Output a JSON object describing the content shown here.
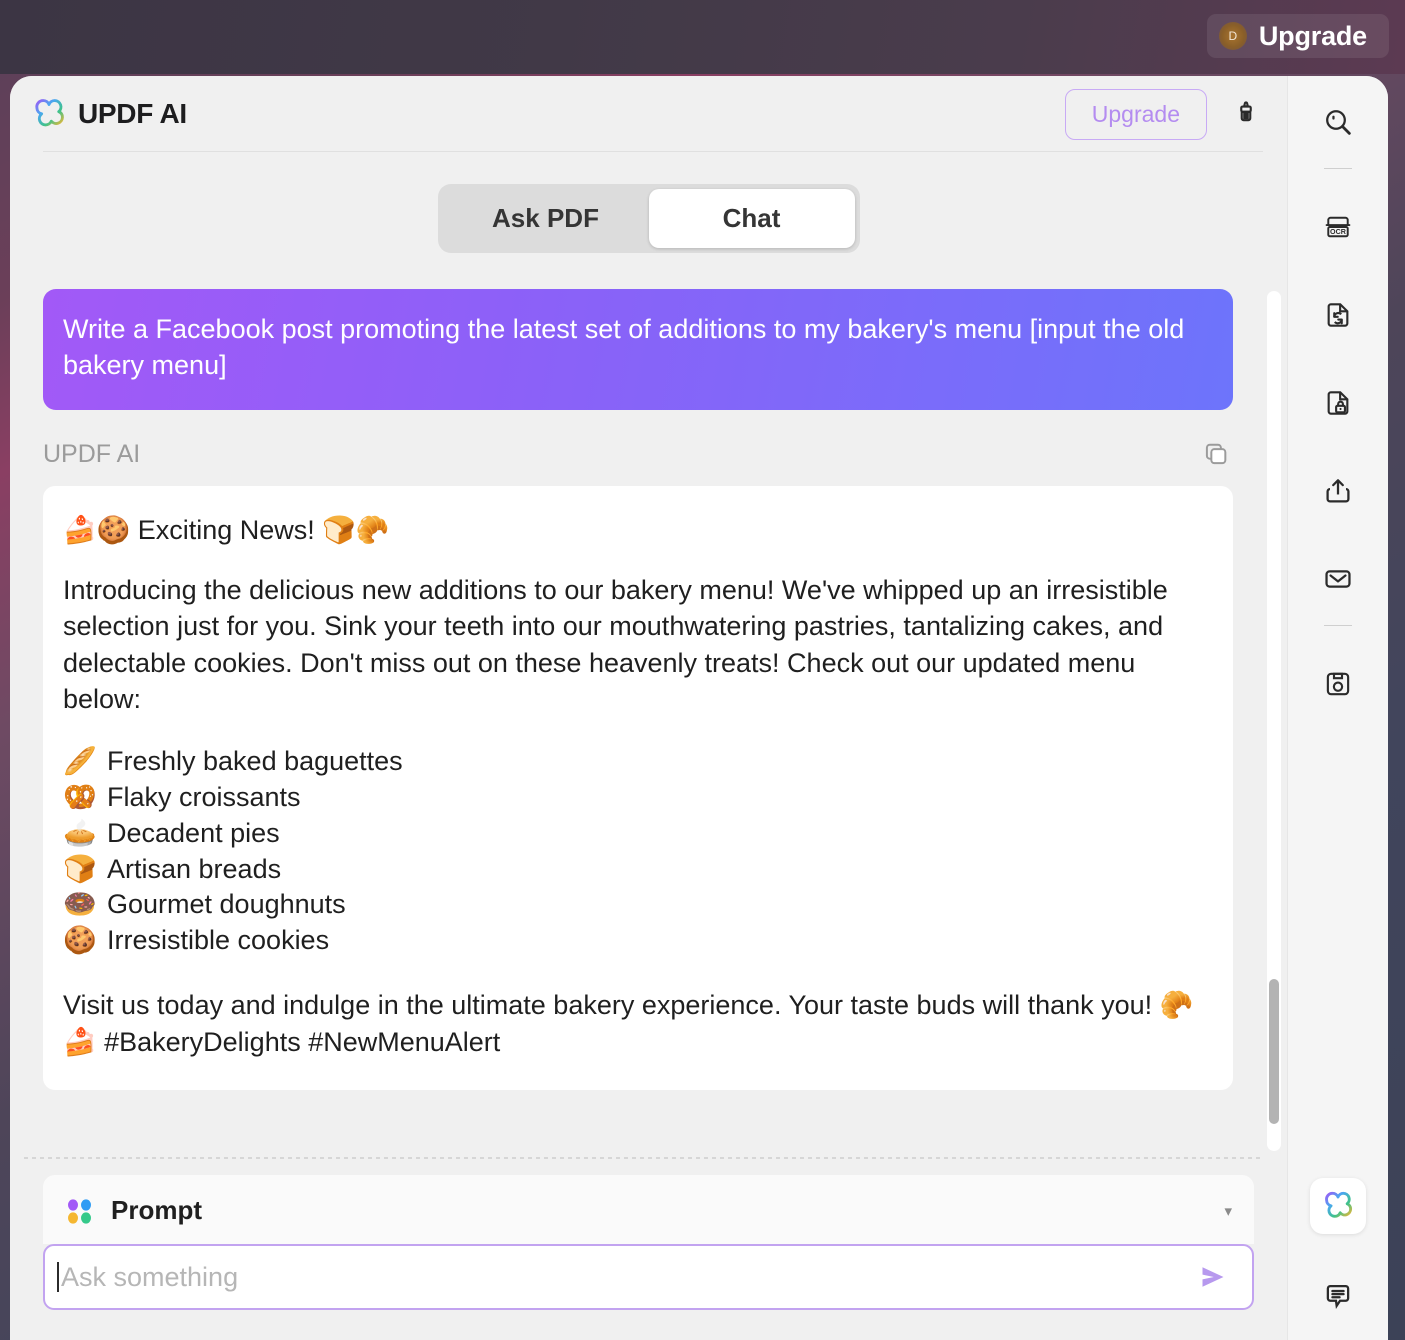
{
  "desktop": {
    "upgrade": {
      "avatar_initial": "D",
      "label": "Upgrade"
    }
  },
  "app": {
    "title": "UPDF AI",
    "header": {
      "upgrade_label": "Upgrade",
      "brush_icon": "brush-icon",
      "logo_icon": "updf-clover-logo-icon"
    },
    "tabs": [
      {
        "label": "Ask PDF",
        "active": false
      },
      {
        "label": "Chat",
        "active": true
      }
    ]
  },
  "chat": {
    "user_message": "Write a Facebook post promoting the latest set of additions to my bakery's menu [input the old bakery menu]",
    "assistant_label": "UPDF AI",
    "copy_icon": "copy-icon",
    "response": {
      "headline": "🍰🍪 Exciting News! 🍞🥐",
      "intro": "Introducing the delicious new additions to our bakery menu! We've whipped up an irresistible selection just for you. Sink your teeth into our mouthwatering pastries, tantalizing cakes, and delectable cookies. Don't miss out on these heavenly treats! Check out our updated menu below:",
      "menu_items": [
        {
          "emoji": "🥖",
          "text": "Freshly baked baguettes"
        },
        {
          "emoji": "🥨",
          "text": "Flaky croissants"
        },
        {
          "emoji": "🥧",
          "text": "Decadent pies"
        },
        {
          "emoji": "🍞",
          "text": "Artisan breads"
        },
        {
          "emoji": "🍩",
          "text": "Gourmet doughnuts"
        },
        {
          "emoji": "🍪",
          "text": "Irresistible cookies"
        }
      ],
      "closing": "Visit us today and indulge in the ultimate bakery experience. Your taste buds will thank you! 🥐🍰 #BakeryDelights #NewMenuAlert"
    }
  },
  "prompt": {
    "label": "Prompt",
    "dots_icon": "four-dots-icon",
    "caret": "▾",
    "input_value": "",
    "placeholder": "Ask something",
    "send_icon": "send-icon"
  },
  "tool_rail": {
    "items": [
      {
        "name": "search-icon",
        "label": "Search"
      },
      {
        "name": "ocr-icon",
        "label": "OCR"
      },
      {
        "name": "convert-document-icon",
        "label": "Convert"
      },
      {
        "name": "protect-document-icon",
        "label": "Protect"
      },
      {
        "name": "share-export-icon",
        "label": "Share"
      },
      {
        "name": "mail-icon",
        "label": "Email"
      },
      {
        "name": "save-floppy-icon",
        "label": "Save"
      }
    ],
    "bottom": [
      {
        "name": "updf-ai-clover-icon",
        "label": "UPDF AI"
      },
      {
        "name": "comment-icon",
        "label": "Comment"
      }
    ]
  },
  "colors": {
    "accent_purple": "#a259f7",
    "accent_blue": "#6d74fb",
    "border_purple": "#c2a3f0",
    "panel_bg": "#f0f0f0",
    "card_bg": "#ffffff"
  }
}
